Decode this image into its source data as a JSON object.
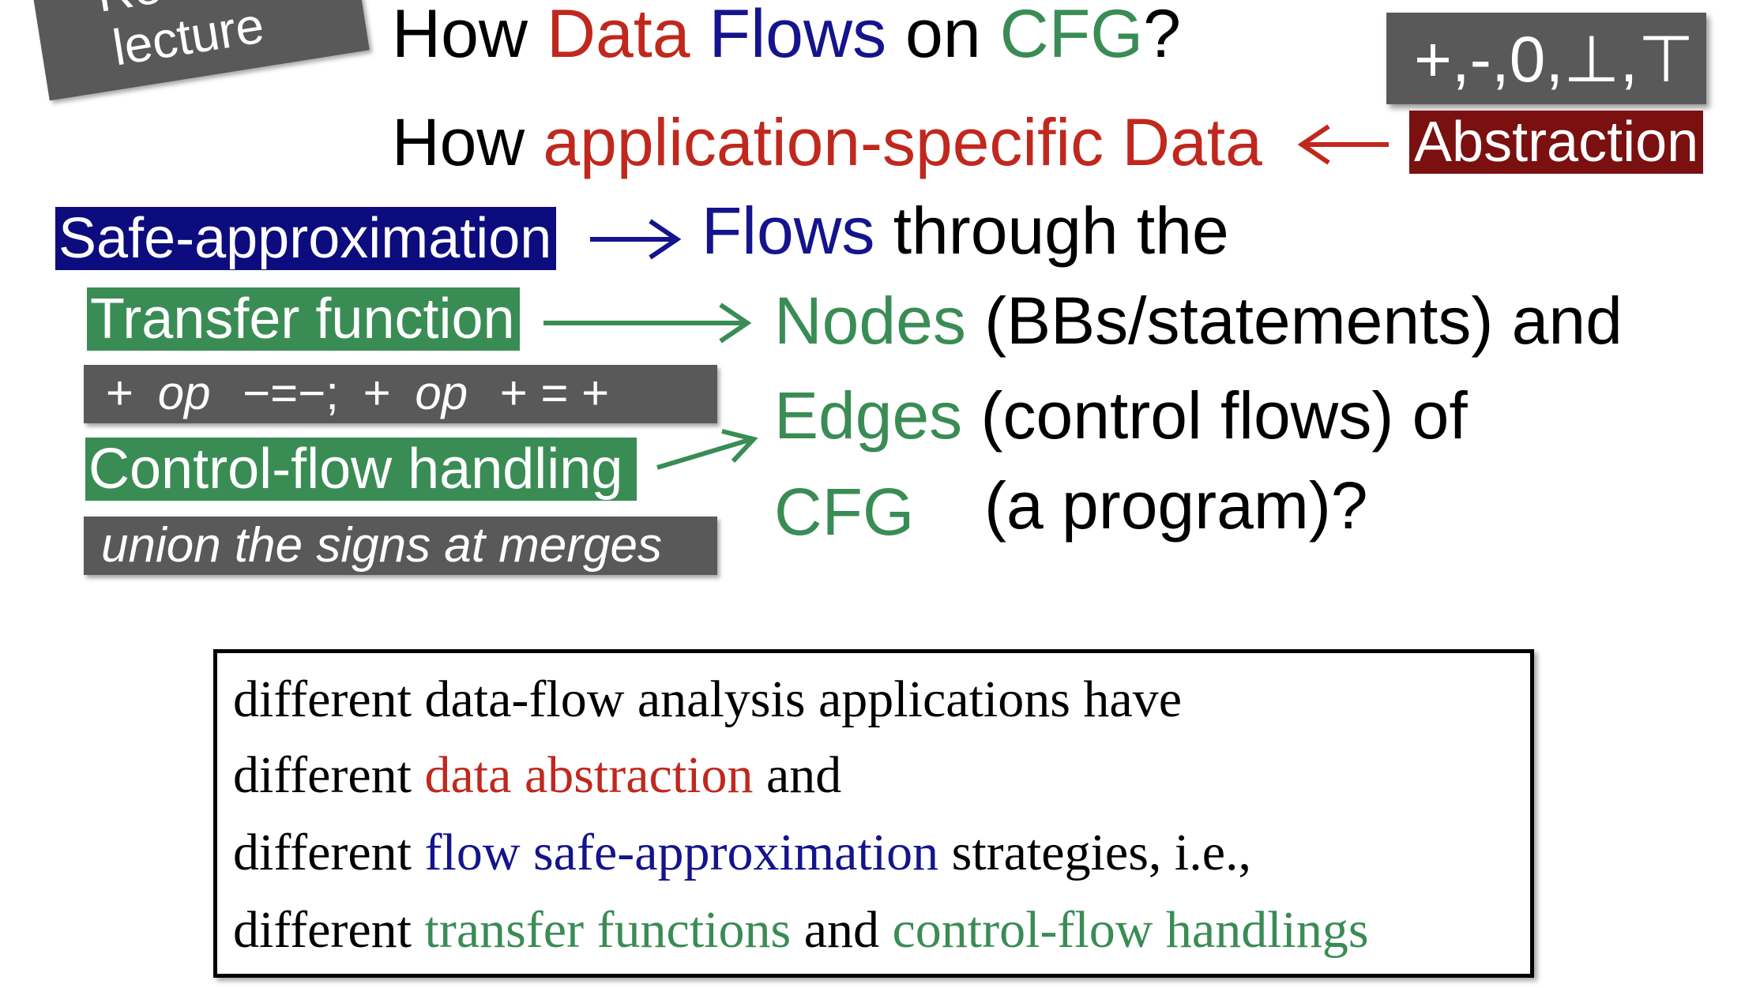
{
  "stamp": {
    "line1": "Re",
    "line2": "lecture"
  },
  "title": {
    "how": "How",
    "data": "Data",
    "flows": "Flows",
    "on": "on",
    "cfg": "CFG",
    "qmark": "?"
  },
  "signs": "+,-,0,⊥,⊤",
  "line2": {
    "how": "How",
    "app_data": "application-specific Data"
  },
  "abstraction": "Abstraction",
  "safe_approx": "Safe-approximation",
  "flows_through": {
    "flows": "Flows",
    "rest": "through the"
  },
  "transfer_function": "Transfer function",
  "nodes_line": {
    "nodes": "Nodes",
    "rest": "(BBs/statements) and"
  },
  "op_rule": {
    "plus1": "+",
    "op1": "op",
    "minus_eq": "−=−;",
    "plus2": "+",
    "op2": "op",
    "plus_eq": "+ = +"
  },
  "edges_line": {
    "edges": "Edges",
    "rest": "(control flows) of"
  },
  "control_flow_handling": "Control-flow handling",
  "cfg_line": {
    "cfg": "CFG",
    "rest": "(a program)?"
  },
  "union_note": "union the signs at merges",
  "summary": {
    "l1": "different data-flow analysis applications have",
    "l2_a": "different",
    "l2_b": "data abstraction",
    "l2_c": "and",
    "l3_a": "different",
    "l3_b": "flow safe-approximation",
    "l3_c": "strategies, i.e.,",
    "l4_a": "different",
    "l4_b": "transfer functions",
    "l4_c": "and",
    "l4_d": "control-flow handlings"
  },
  "colors": {
    "red": "#c0281e",
    "navy": "#14148c",
    "green": "#3a8c55",
    "gray_box": "#595959",
    "dark_red": "#7b1010"
  }
}
